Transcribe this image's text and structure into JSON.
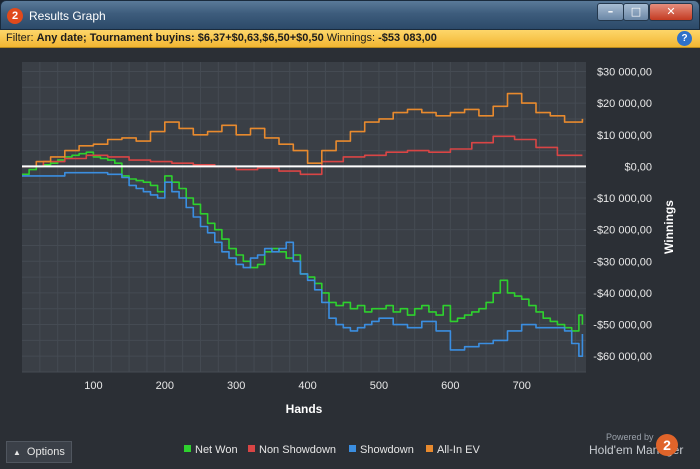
{
  "window": {
    "title": "Results Graph",
    "app_icon": "2",
    "buttons": {
      "minimize": "–",
      "maximize": "□",
      "close": "✕"
    }
  },
  "filter": {
    "prefix": "Filter:",
    "criteria": "Any date; Tournament buyins: $6,37+$0,63,$6,50+$0,50",
    "winnings_label": "Winnings:",
    "winnings_value": "-$53 083,00",
    "help_icon": "?"
  },
  "footer": {
    "options_label": "Options",
    "powered_by": "Powered by",
    "brand_name": "Hold'em Manager",
    "brand_logo": "2"
  },
  "colors": {
    "net_won": "#2ed12e",
    "non_showdown": "#d94545",
    "showdown": "#3b8ee0",
    "all_in_ev": "#e88a2e",
    "zero_line": "#ffffff"
  },
  "chart_data": {
    "type": "line",
    "xlabel": "Hands",
    "ylabel": "Winnings",
    "xlim": [
      0,
      790
    ],
    "ylim": [
      -65000,
      33000
    ],
    "x_ticks": [
      100,
      200,
      300,
      400,
      500,
      600,
      700
    ],
    "y_ticks": [
      30000,
      20000,
      10000,
      0,
      -10000,
      -20000,
      -30000,
      -40000,
      -50000,
      -60000
    ],
    "y_tick_labels": [
      "$30 000,00",
      "$20 000,00",
      "$10 000,00",
      "$0,00",
      "-$10 000,00",
      "-$20 000,00",
      "-$30 000,00",
      "-$40 000,00",
      "-$50 000,00",
      "-$60 000,00"
    ],
    "grid": true,
    "legend_position": "bottom",
    "series": [
      {
        "name": "Net Won",
        "color": "#2ed12e",
        "x": [
          0,
          10,
          20,
          30,
          40,
          50,
          60,
          70,
          80,
          90,
          100,
          110,
          120,
          130,
          140,
          150,
          160,
          170,
          180,
          190,
          200,
          210,
          220,
          230,
          240,
          250,
          260,
          270,
          280,
          290,
          300,
          310,
          320,
          330,
          340,
          350,
          360,
          370,
          380,
          390,
          400,
          410,
          420,
          430,
          440,
          450,
          460,
          470,
          480,
          490,
          500,
          510,
          520,
          530,
          540,
          550,
          560,
          570,
          580,
          590,
          600,
          610,
          620,
          630,
          640,
          650,
          660,
          670,
          680,
          690,
          700,
          710,
          720,
          730,
          740,
          750,
          760,
          770,
          780,
          785
        ],
        "y": [
          -2500,
          -1000,
          0,
          500,
          1000,
          2000,
          3000,
          3500,
          4000,
          4500,
          3000,
          2500,
          2000,
          1000,
          -3000,
          -4000,
          -4500,
          -5000,
          -6000,
          -8000,
          -3000,
          -5000,
          -7000,
          -10000,
          -12000,
          -15000,
          -18000,
          -20000,
          -23000,
          -26000,
          -28000,
          -30000,
          -32000,
          -31000,
          -27000,
          -26000,
          -27000,
          -29000,
          -28000,
          -34000,
          -35000,
          -37000,
          -40000,
          -43000,
          -44000,
          -43000,
          -45000,
          -44000,
          -46000,
          -45000,
          -45000,
          -44000,
          -46000,
          -45000,
          -47000,
          -45000,
          -44000,
          -46000,
          -47000,
          -44000,
          -49000,
          -48000,
          -47000,
          -46000,
          -45000,
          -43000,
          -40000,
          -36000,
          -40000,
          -41000,
          -42000,
          -44000,
          -46000,
          -48000,
          -49000,
          -50000,
          -51000,
          -52000,
          -47000,
          -50000
        ]
      },
      {
        "name": "Non Showdown",
        "color": "#d94545",
        "x": [
          0,
          30,
          60,
          90,
          120,
          150,
          180,
          210,
          240,
          270,
          300,
          330,
          360,
          390,
          420,
          450,
          480,
          510,
          540,
          570,
          600,
          630,
          660,
          690,
          720,
          750,
          785
        ],
        "y": [
          0,
          1500,
          2500,
          3500,
          3000,
          2000,
          1500,
          1000,
          500,
          0,
          -1000,
          -500,
          -1500,
          -2500,
          1500,
          3000,
          3500,
          4500,
          5000,
          4500,
          5500,
          7500,
          9500,
          8500,
          6000,
          3500,
          3500
        ]
      },
      {
        "name": "Showdown",
        "color": "#3b8ee0",
        "x": [
          0,
          30,
          60,
          90,
          120,
          140,
          150,
          160,
          170,
          180,
          190,
          200,
          210,
          220,
          230,
          240,
          250,
          260,
          270,
          280,
          290,
          300,
          310,
          320,
          330,
          340,
          350,
          360,
          370,
          380,
          390,
          400,
          410,
          420,
          430,
          440,
          450,
          460,
          470,
          480,
          490,
          500,
          520,
          540,
          560,
          580,
          600,
          620,
          640,
          660,
          680,
          700,
          720,
          740,
          760,
          770,
          780,
          785
        ],
        "y": [
          -3000,
          -3000,
          -2000,
          -2000,
          -2500,
          -3500,
          -6000,
          -7000,
          -8000,
          -9000,
          -10000,
          -5000,
          -8000,
          -10000,
          -13000,
          -16000,
          -19000,
          -21000,
          -24000,
          -27000,
          -29000,
          -31000,
          -32000,
          -29000,
          -28000,
          -26000,
          -27000,
          -26000,
          -24000,
          -30000,
          -34000,
          -36000,
          -39000,
          -43000,
          -48000,
          -50000,
          -51000,
          -52000,
          -51000,
          -50000,
          -49000,
          -48000,
          -50000,
          -51000,
          -49000,
          -52000,
          -58000,
          -57000,
          -56000,
          -55000,
          -52000,
          -50000,
          -51000,
          -51000,
          -52000,
          -56000,
          -60000,
          -53000
        ]
      },
      {
        "name": "All-In EV",
        "color": "#e88a2e",
        "x": [
          0,
          20,
          40,
          60,
          80,
          100,
          120,
          140,
          160,
          180,
          200,
          220,
          240,
          260,
          280,
          300,
          320,
          340,
          360,
          380,
          400,
          420,
          440,
          460,
          480,
          500,
          520,
          540,
          560,
          580,
          600,
          620,
          640,
          660,
          680,
          700,
          720,
          740,
          760,
          785
        ],
        "y": [
          0,
          1500,
          3000,
          5000,
          6500,
          7000,
          8500,
          9000,
          8000,
          11000,
          14000,
          12000,
          10000,
          11000,
          13000,
          10000,
          12000,
          9000,
          7000,
          5000,
          1000,
          5000,
          8000,
          11000,
          14000,
          15000,
          17000,
          18000,
          17000,
          16000,
          17000,
          18000,
          16000,
          19000,
          23000,
          20000,
          17000,
          16000,
          14000,
          15000
        ]
      }
    ]
  }
}
